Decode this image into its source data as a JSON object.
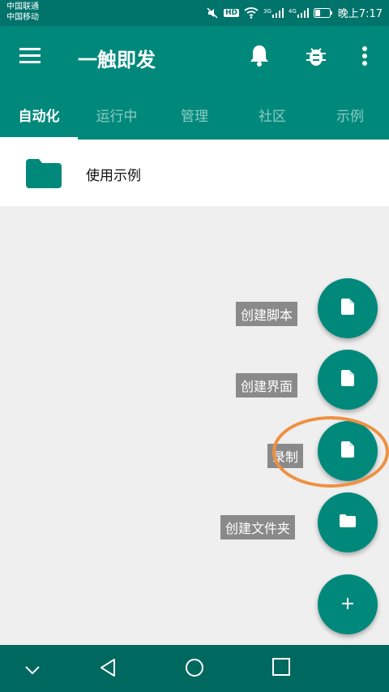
{
  "status_bar": {
    "carrier1": "中国联通",
    "carrier2": "中国移动",
    "hd_label": "HD",
    "net1": "3G",
    "net2": "4G",
    "time": "晚上7:17"
  },
  "app_bar": {
    "title": "一触即发"
  },
  "tabs": [
    {
      "label": "自动化",
      "active": true
    },
    {
      "label": "运行中",
      "active": false
    },
    {
      "label": "管理",
      "active": false
    },
    {
      "label": "社区",
      "active": false
    },
    {
      "label": "示例",
      "active": false
    }
  ],
  "list": {
    "items": [
      {
        "label": "使用示例",
        "icon": "folder-icon"
      }
    ]
  },
  "fab_menu": {
    "items": [
      {
        "label": "创建脚本",
        "icon": "file-icon"
      },
      {
        "label": "创建界面",
        "icon": "file-icon"
      },
      {
        "label": "录制",
        "icon": "file-icon"
      },
      {
        "label": "创建文件夹",
        "icon": "folder-icon"
      }
    ],
    "main_icon": "plus-icon"
  },
  "colors": {
    "primary": "#00897b",
    "status": "#00736b",
    "highlight": "#ee9142"
  }
}
